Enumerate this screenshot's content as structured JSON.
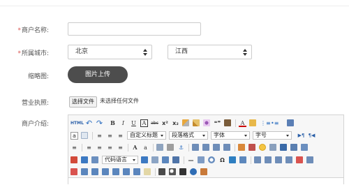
{
  "form": {
    "merchant_name": {
      "required_mark": "*",
      "label": "商户名称:",
      "value": ""
    },
    "city": {
      "required_mark": "*",
      "label": "所属城市:",
      "province": "北京",
      "city": "江西"
    },
    "thumbnail": {
      "label": "缩略图:",
      "upload_button": "图片上传"
    },
    "license": {
      "label": "营业执照:",
      "choose_button": "选择文件",
      "no_file_text": "未选择任何文件"
    },
    "intro": {
      "label": "商户介绍:"
    }
  },
  "editor": {
    "combos": {
      "custom_title": "自定义标题",
      "paragraph_format": "段落格式",
      "font_family": "字体",
      "font_size": "字号",
      "code_language": "代码语言"
    },
    "glyphs": {
      "html": "HTML",
      "undo": "↶",
      "redo": "↷",
      "bold": "B",
      "italic": "I",
      "underline": "U",
      "font_border": "A",
      "strikethrough": "abc",
      "superscript": "x²",
      "subscript": "x₂",
      "blockquote": "❝❞",
      "font_color": "A",
      "ordered_list": "⋮≡",
      "unordered_list": "•≡",
      "font_a": "a",
      "rowspacing": "≡",
      "ltr": "▶¶",
      "rtl": "¶◀",
      "anchor": "⚓",
      "omega": "Ω"
    }
  }
}
